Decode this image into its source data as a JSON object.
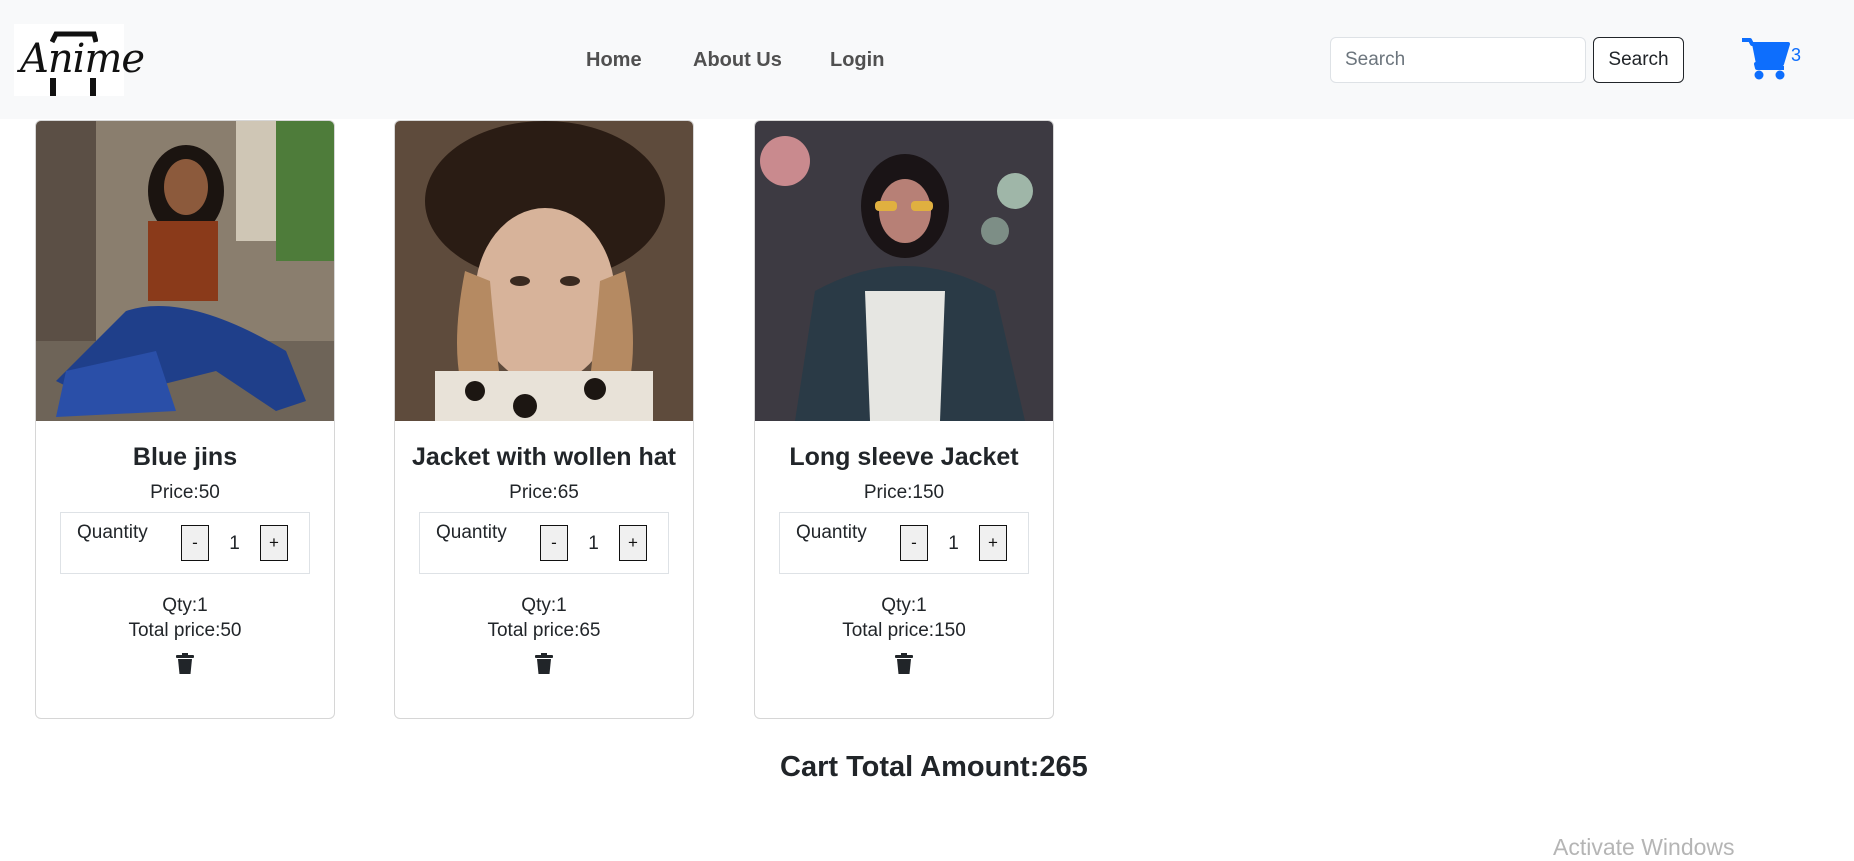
{
  "brand": {
    "logo_text": "Anime"
  },
  "nav": {
    "links": [
      {
        "label": "Home"
      },
      {
        "label": "About Us"
      },
      {
        "label": "Login"
      }
    ]
  },
  "search": {
    "placeholder": "Search",
    "value": "",
    "button_label": "Search"
  },
  "cart": {
    "icon": "cart-icon",
    "count": "3",
    "accent_color": "#0d6efd"
  },
  "products": [
    {
      "name": "Blue jins",
      "price_text": "Price:50",
      "quantity_label": "Quantity",
      "minus_label": "-",
      "plus_label": "+",
      "quantity_value": "1",
      "qty_text": "Qty:1",
      "total_text": "Total price:50",
      "delete_icon": "trash-icon"
    },
    {
      "name": "Jacket with wollen hat",
      "price_text": "Price:65",
      "quantity_label": "Quantity",
      "minus_label": "-",
      "plus_label": "+",
      "quantity_value": "1",
      "qty_text": "Qty:1",
      "total_text": "Total price:65",
      "delete_icon": "trash-icon"
    },
    {
      "name": "Long sleeve Jacket",
      "price_text": "Price:150",
      "quantity_label": "Quantity",
      "minus_label": "-",
      "plus_label": "+",
      "quantity_value": "1",
      "qty_text": "Qty:1",
      "total_text": "Total price:150",
      "delete_icon": "trash-icon"
    }
  ],
  "cart_total": "Cart Total Amount:265",
  "watermark": "Activate Windows"
}
